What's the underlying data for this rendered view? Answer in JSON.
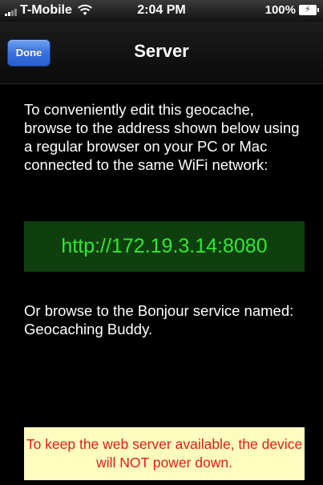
{
  "status_bar": {
    "carrier": "T-Mobile",
    "time": "2:04 PM",
    "battery": "100%"
  },
  "nav": {
    "title": "Server",
    "done_label": "Done"
  },
  "content": {
    "instructions": "To conveniently edit this geocache, browse to the address shown below using a regular browser on your PC or Mac connected to the same WiFi network:",
    "url": "http://172.19.3.14:8080",
    "bonjour": "Or browse to the Bonjour service named: Geocaching Buddy.",
    "warning": "To keep the web server available, the device will NOT power down."
  },
  "colors": {
    "url_text": "#2fea2f",
    "url_background": "#0f3f0f",
    "warning_text": "#e21b1b",
    "warning_background": "#fdfdc0",
    "done_button": "#3a72dd"
  },
  "icons": [
    "signal-icon",
    "wifi-icon",
    "battery-icon"
  ]
}
